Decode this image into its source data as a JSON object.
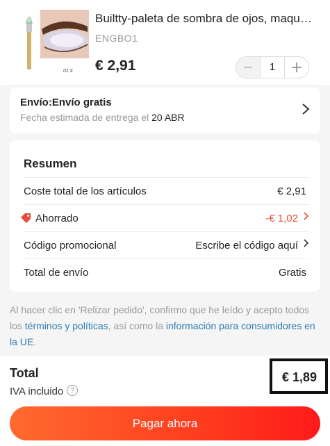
{
  "product": {
    "title": "Builtty-paleta de sombra de ojos, maqu…",
    "variant": "ENGBO1",
    "thumb_caption": "01 #",
    "price": "€ 2,91",
    "quantity": "1",
    "minus_icon": "minus-icon",
    "plus_icon": "plus-icon"
  },
  "shipping": {
    "title": "Envío:Envío gratis",
    "eta_prefix": "Fecha estimada de entrega el",
    "eta_date": "20 ABR"
  },
  "summary": {
    "heading": "Resumen",
    "rows": [
      {
        "label": "Coste total de los artículos",
        "value": "€ 2,91"
      },
      {
        "label": "Ahorrado",
        "value": "-€ 1,02"
      },
      {
        "label": "Código promocional",
        "value": "Escribe el código aquí"
      },
      {
        "label": "Total de envío",
        "value": "Gratis"
      }
    ]
  },
  "legal": {
    "text_1": "Al hacer clic en 'Relizar pedido', confirmo que he leído y acepto todos los",
    "link_1": "términos y políticas",
    "text_2": ", así como la",
    "link_2": "información para consumidores en la UE",
    "text_3": "."
  },
  "footer": {
    "total_label": "Total",
    "total_value": "€ 1,89",
    "iva_label": "IVA incluido",
    "info_icon": "?",
    "pay_button": "Pagar ahora"
  },
  "colors": {
    "accent_red": "#e94b3c",
    "link_blue": "#2a7bb4",
    "button_gradient_start": "#ff6a2e",
    "button_gradient_end": "#ff1a1a"
  }
}
